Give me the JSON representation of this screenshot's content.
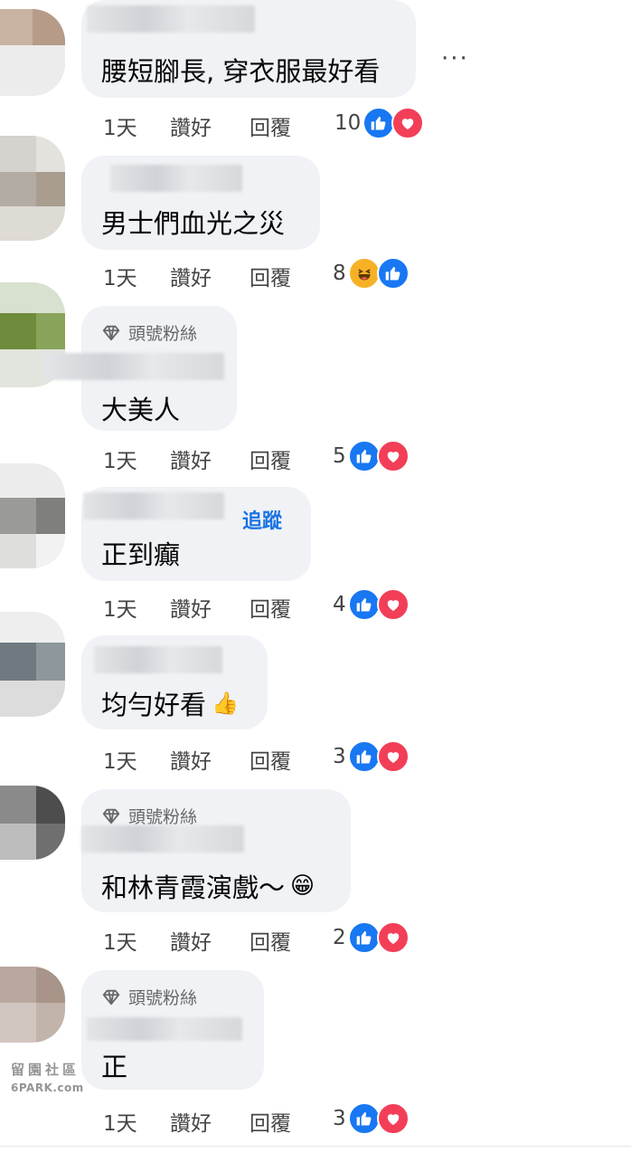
{
  "menu": {
    "more_label": "···"
  },
  "action_labels": {
    "time": "1天",
    "like": "讚好",
    "reply": "回覆"
  },
  "colors": {
    "like": "#1877f2",
    "love": "#f33e58",
    "haha": "#f7b125",
    "follow": "#1b74e4",
    "bubble": "#f0f2f5"
  },
  "comments": [
    {
      "badge": "",
      "follow": "",
      "text": "腰短腳長, 穿衣服最好看",
      "emoji": "",
      "reaction_count": "10",
      "reactions": [
        "like-icon",
        "love-icon"
      ]
    },
    {
      "badge": "",
      "follow": "",
      "text": "男士們血光之災",
      "emoji": "",
      "reaction_count": "8",
      "reactions": [
        "haha-icon",
        "like-icon"
      ]
    },
    {
      "badge": "頭號粉絲",
      "follow": "",
      "text": "大美人",
      "emoji": "",
      "reaction_count": "5",
      "reactions": [
        "like-icon",
        "love-icon"
      ]
    },
    {
      "badge": "",
      "follow": "追蹤",
      "text": "正到癲",
      "emoji": "",
      "reaction_count": "4",
      "reactions": [
        "like-icon",
        "love-icon"
      ]
    },
    {
      "badge": "",
      "follow": "",
      "text": "均勻好看",
      "emoji": "👍",
      "reaction_count": "3",
      "reactions": [
        "like-icon",
        "love-icon"
      ]
    },
    {
      "badge": "頭號粉絲",
      "follow": "",
      "text": "和林青霞演戲～",
      "emoji": "😁",
      "reaction_count": "2",
      "reactions": [
        "like-icon",
        "love-icon"
      ]
    },
    {
      "badge": "頭號粉絲",
      "follow": "",
      "text": "正",
      "emoji": "",
      "reaction_count": "3",
      "reactions": [
        "like-icon",
        "love-icon"
      ]
    }
  ],
  "watermark": {
    "line1": "留園社區",
    "line2": "6PARK.com"
  }
}
